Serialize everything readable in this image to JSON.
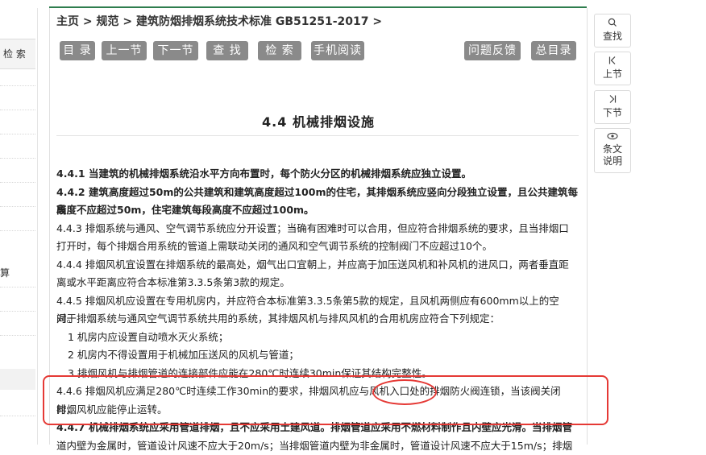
{
  "left": {
    "search_label": "检 索",
    "item_text": "算"
  },
  "breadcrumb": {
    "home": "主页",
    "sep1": " > ",
    "spec": "规范",
    "sep2": " > ",
    "doc": "建筑防烟排烟系统技术标准 GB51251-2017",
    "sep3": " >"
  },
  "toolbar": {
    "toc": "目 录",
    "prev": "上一节",
    "next": "下一节",
    "find": "查 找",
    "search": "检 索",
    "mobile": "手机阅读",
    "feedback": "问题反馈",
    "master_toc": "总目录"
  },
  "section": {
    "title": "4.4 机械排烟设施",
    "paragraphs": [
      "4.4.1 当建筑的机械排烟系统沿水平方向布置时，每个防火分区的机械排烟系统应独立设置。",
      "4.4.2 建筑高度超过50m的公共建筑和建筑高度超过100m的住宅，其排烟系统应竖向分段独立设置，且公共建筑每段",
      "高度不应超过50m，住宅建筑每段高度不应超过100m。",
      "4.4.3 排烟系统与通风、空气调节系统应分开设置；当确有困难时可以合用，但应符合排烟系统的要求，且当排烟口",
      "打开时，每个排烟合用系统的管道上需联动关闭的通风和空气调节系统的控制阀门不应超过10个。",
      "4.4.4 排烟风机宜设置在排烟系统的最高处，烟气出口宜朝上，并应高于加压送风机和补风机的进风口，两者垂直距",
      "离或水平距离应符合本标准第3.3.5条第3款的规定。",
      "4.4.5 排烟风机应设置在专用机房内，并应符合本标准第3.3.5条第5款的规定，且风机两侧应有600mm以上的空间。",
      "对于排烟系统与通风空气调节系统共用的系统，其排烟风机与排风风机的合用机房应符合下列规定：",
      "1 机房内应设置自动喷水灭火系统；",
      "2 机房内不得设置用于机械加压送风的风机与管道；",
      "3 排烟风机与排烟管道的连接部件应能在280℃时连续30min保证其结构完整性。",
      "4.4.6 排烟风机应满足280℃时连续工作30min的要求，排烟风机应与风机入口处的排烟防火阀连锁，当该阀关闭时，",
      "排烟风机应能停止运转。",
      "4.4.7 机械排烟系统应采用管道排烟，且不应采用土建风道。排烟管道应采用不燃材料制作且内壁应光滑。当排烟管",
      "道内壁为金属时，管道设计风速不应大于20m/s；当排烟管道内壁为非金属时，管道设计风速不应大于15m/s；排烟"
    ]
  },
  "tools": {
    "find": "查找",
    "prev": "上节",
    "next": "下节",
    "explain_line1": "条文",
    "explain_line2": "说明"
  },
  "colors": {
    "accent_green": "#2e7d4e",
    "button_grey": "#8a8a8a",
    "annotation_red": "#e53935"
  }
}
